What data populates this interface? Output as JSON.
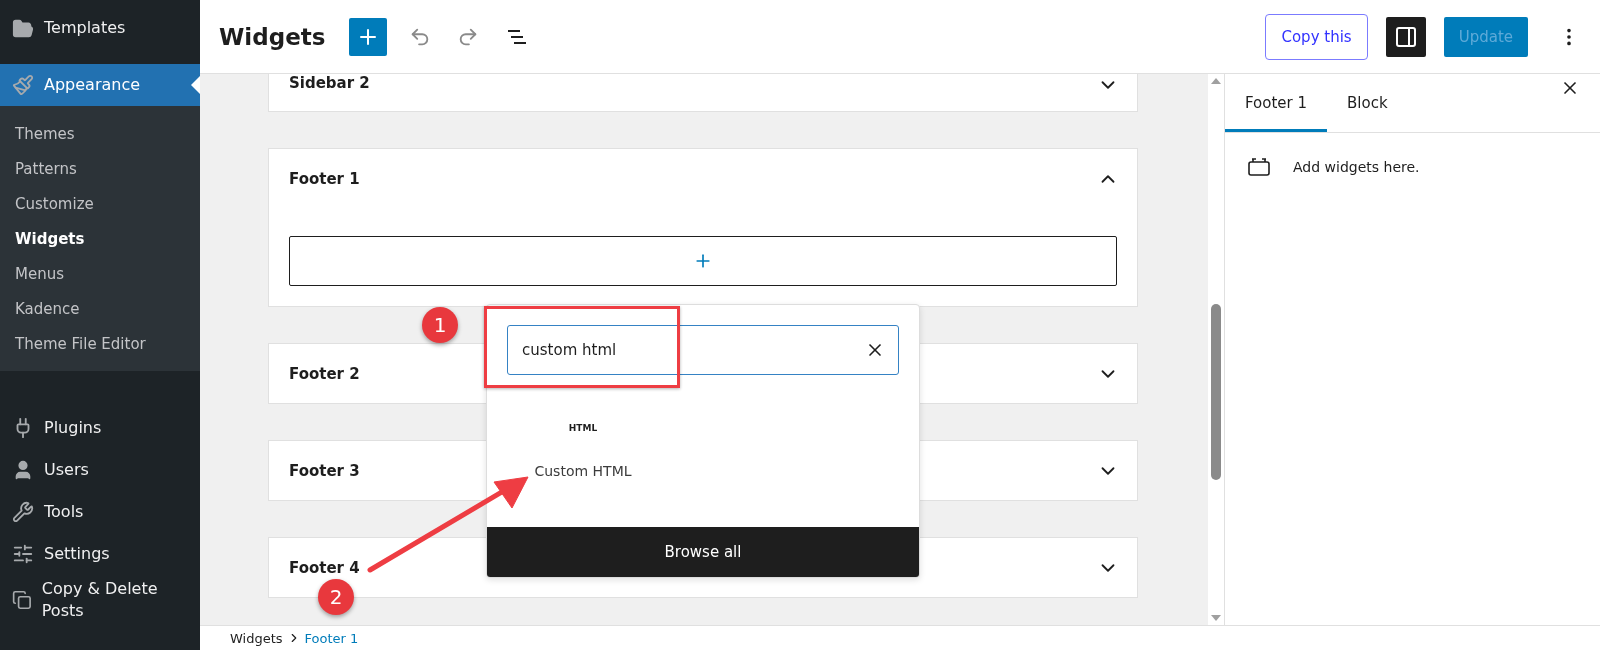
{
  "admin_menu": {
    "items": [
      {
        "label": "Templates",
        "selected": false
      },
      {
        "label": "Appearance",
        "selected": true,
        "submenu": [
          {
            "label": "Themes",
            "selected": false
          },
          {
            "label": "Patterns",
            "selected": false
          },
          {
            "label": "Customize",
            "selected": false
          },
          {
            "label": "Widgets",
            "selected": true
          },
          {
            "label": "Menus",
            "selected": false
          },
          {
            "label": "Kadence",
            "selected": false
          },
          {
            "label": "Theme File Editor",
            "selected": false
          }
        ]
      },
      {
        "label": "Plugins",
        "selected": false
      },
      {
        "label": "Users",
        "selected": false
      },
      {
        "label": "Tools",
        "selected": false
      },
      {
        "label": "Settings",
        "selected": false
      },
      {
        "label": "Copy & Delete Posts",
        "selected": false
      }
    ]
  },
  "header": {
    "title": "Widgets",
    "copy_button": "Copy this",
    "update_button": "Update",
    "update_disabled": true
  },
  "widget_areas": [
    {
      "title": "Sidebar 2",
      "expanded": false
    },
    {
      "title": "Footer 1",
      "expanded": true
    },
    {
      "title": "Footer 2",
      "expanded": false
    },
    {
      "title": "Footer 3",
      "expanded": false
    },
    {
      "title": "Footer 4",
      "expanded": false
    }
  ],
  "inserter": {
    "search_value": "custom html",
    "results": [
      {
        "icon_text": "HTML",
        "label": "Custom HTML"
      }
    ],
    "browse_all": "Browse all"
  },
  "annotations": [
    {
      "label": "1"
    },
    {
      "label": "2"
    }
  ],
  "settings_panel": {
    "tabs": [
      {
        "label": "Footer 1",
        "selected": true
      },
      {
        "label": "Block",
        "selected": false
      }
    ],
    "message": "Add widgets here."
  },
  "breadcrumb": [
    "Widgets",
    "Footer 1"
  ]
}
